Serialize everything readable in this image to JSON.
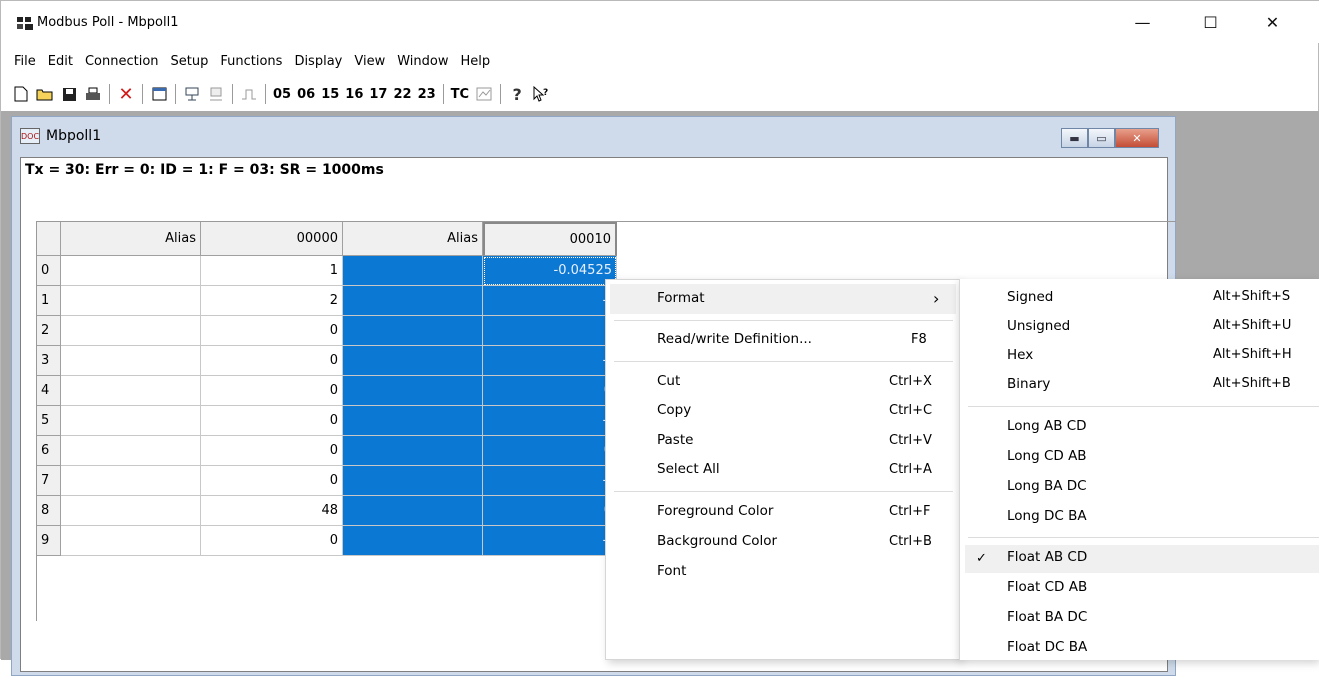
{
  "window": {
    "title": "Modbus Poll - Mbpoll1",
    "controls": {
      "minimize": "—",
      "maximize": "☐",
      "close": "✕"
    }
  },
  "menubar": [
    "File",
    "Edit",
    "Connection",
    "Setup",
    "Functions",
    "Display",
    "View",
    "Window",
    "Help"
  ],
  "toolbar": {
    "icons": [
      "new-icon",
      "open-icon",
      "save-icon",
      "print-icon",
      "delete-icon",
      "window-icon",
      "connect-icon",
      "disconnect-icon",
      "pulse-icon"
    ],
    "function_codes": [
      "05",
      "06",
      "15",
      "16",
      "17",
      "22",
      "23"
    ],
    "tc_label": "TC",
    "help_icons": [
      "help-icon",
      "context-help-icon"
    ]
  },
  "child": {
    "title": "Mbpoll1",
    "status": "Tx = 30: Err = 0: ID = 1: F = 03: SR = 1000ms"
  },
  "grid": {
    "headers": [
      "Alias",
      "00000",
      "Alias",
      "00010"
    ],
    "rows": [
      {
        "idx": "0",
        "alias1": "",
        "v1": "1",
        "alias2": "",
        "v2": "-0.04525"
      },
      {
        "idx": "1",
        "alias1": "",
        "v1": "2",
        "alias2": "",
        "v2": "--"
      },
      {
        "idx": "2",
        "alias1": "",
        "v1": "0",
        "alias2": "",
        "v2": "1"
      },
      {
        "idx": "3",
        "alias1": "",
        "v1": "0",
        "alias2": "",
        "v2": "--"
      },
      {
        "idx": "4",
        "alias1": "",
        "v1": "0",
        "alias2": "",
        "v2": "0"
      },
      {
        "idx": "5",
        "alias1": "",
        "v1": "0",
        "alias2": "",
        "v2": "--"
      },
      {
        "idx": "6",
        "alias1": "",
        "v1": "0",
        "alias2": "",
        "v2": "0"
      },
      {
        "idx": "7",
        "alias1": "",
        "v1": "0",
        "alias2": "",
        "v2": "--"
      },
      {
        "idx": "8",
        "alias1": "",
        "v1": "48",
        "alias2": "",
        "v2": "0"
      },
      {
        "idx": "9",
        "alias1": "",
        "v1": "0",
        "alias2": "",
        "v2": "--"
      }
    ]
  },
  "context_menu": {
    "format": {
      "label": "Format",
      "arrow": "›"
    },
    "rw": {
      "label": "Read/write Definition...",
      "shortcut": "F8"
    },
    "cut": {
      "label": "Cut",
      "shortcut": "Ctrl+X"
    },
    "copy": {
      "label": "Copy",
      "shortcut": "Ctrl+C"
    },
    "paste": {
      "label": "Paste",
      "shortcut": "Ctrl+V"
    },
    "selectall": {
      "label": "Select All",
      "shortcut": "Ctrl+A"
    },
    "fg": {
      "label": "Foreground Color",
      "shortcut": "Ctrl+F"
    },
    "bg": {
      "label": "Background Color",
      "shortcut": "Ctrl+B"
    },
    "font": {
      "label": "Font"
    }
  },
  "submenu": {
    "signed": {
      "label": "Signed",
      "shortcut": "Alt+Shift+S"
    },
    "unsigned": {
      "label": "Unsigned",
      "shortcut": "Alt+Shift+U"
    },
    "hex": {
      "label": "Hex",
      "shortcut": "Alt+Shift+H"
    },
    "binary": {
      "label": "Binary",
      "shortcut": "Alt+Shift+B"
    },
    "long_abcd": {
      "label": "Long AB CD"
    },
    "long_cdab": {
      "label": "Long CD AB"
    },
    "long_badc": {
      "label": "Long BA DC"
    },
    "long_dcba": {
      "label": "Long DC BA"
    },
    "float_abcd": {
      "label": "Float AB CD",
      "checked": "✓"
    },
    "float_cdab": {
      "label": "Float CD AB"
    },
    "float_badc": {
      "label": "Float BA DC"
    },
    "float_dcba": {
      "label": "Float DC BA"
    }
  },
  "colors": {
    "selection_blue": "#0b78d4",
    "mdi_bg": "#a9a9a9"
  }
}
